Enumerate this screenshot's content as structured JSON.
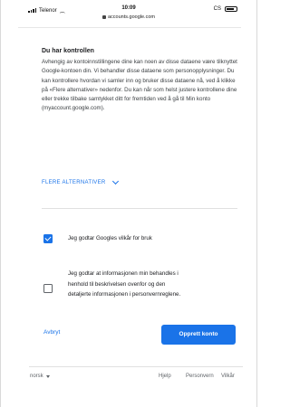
{
  "status_bar": {
    "carrier": "Telenor",
    "time": "10:09",
    "battery_label": "CS",
    "url": "accounts.google.com"
  },
  "content": {
    "title": "Du har kontrollen",
    "body": "Avhengig av kontoinnstillingene dine kan noen av disse dataene være tilknyttet Google-kontoen din. Vi behandler disse dataene som personopplysninger. Du kan kontrollere hvordan vi samler inn og bruker disse dataene nå, ved å klikke på «Flere alternativer» nedenfor. Du kan når som helst justere kontrollene dine eller trekke tilbake samtykket ditt for fremtiden ved å gå til Min konto (myaccount.google.com).",
    "more_options_label": "FLERE ALTERNATIVER"
  },
  "checkboxes": [
    {
      "label": "Jeg godtar Googles vilkår for bruk",
      "checked": true
    },
    {
      "label_lines": [
        "Jeg godtar at informasjonen min behandles i",
        "henhold til beskrivelsen ovenfor og den",
        "detaljerte informasjonen i personvernreglene."
      ],
      "checked": false
    }
  ],
  "buttons": {
    "cancel": "Avbryt",
    "create": "Opprett konto"
  },
  "footer": {
    "language": "norsk",
    "help": "Hjelp",
    "privacy": "Personvern",
    "terms": "Vilkår"
  },
  "colors": {
    "accent": "#1a73e8",
    "text": "#202124",
    "secondary_text": "#5f6368"
  }
}
